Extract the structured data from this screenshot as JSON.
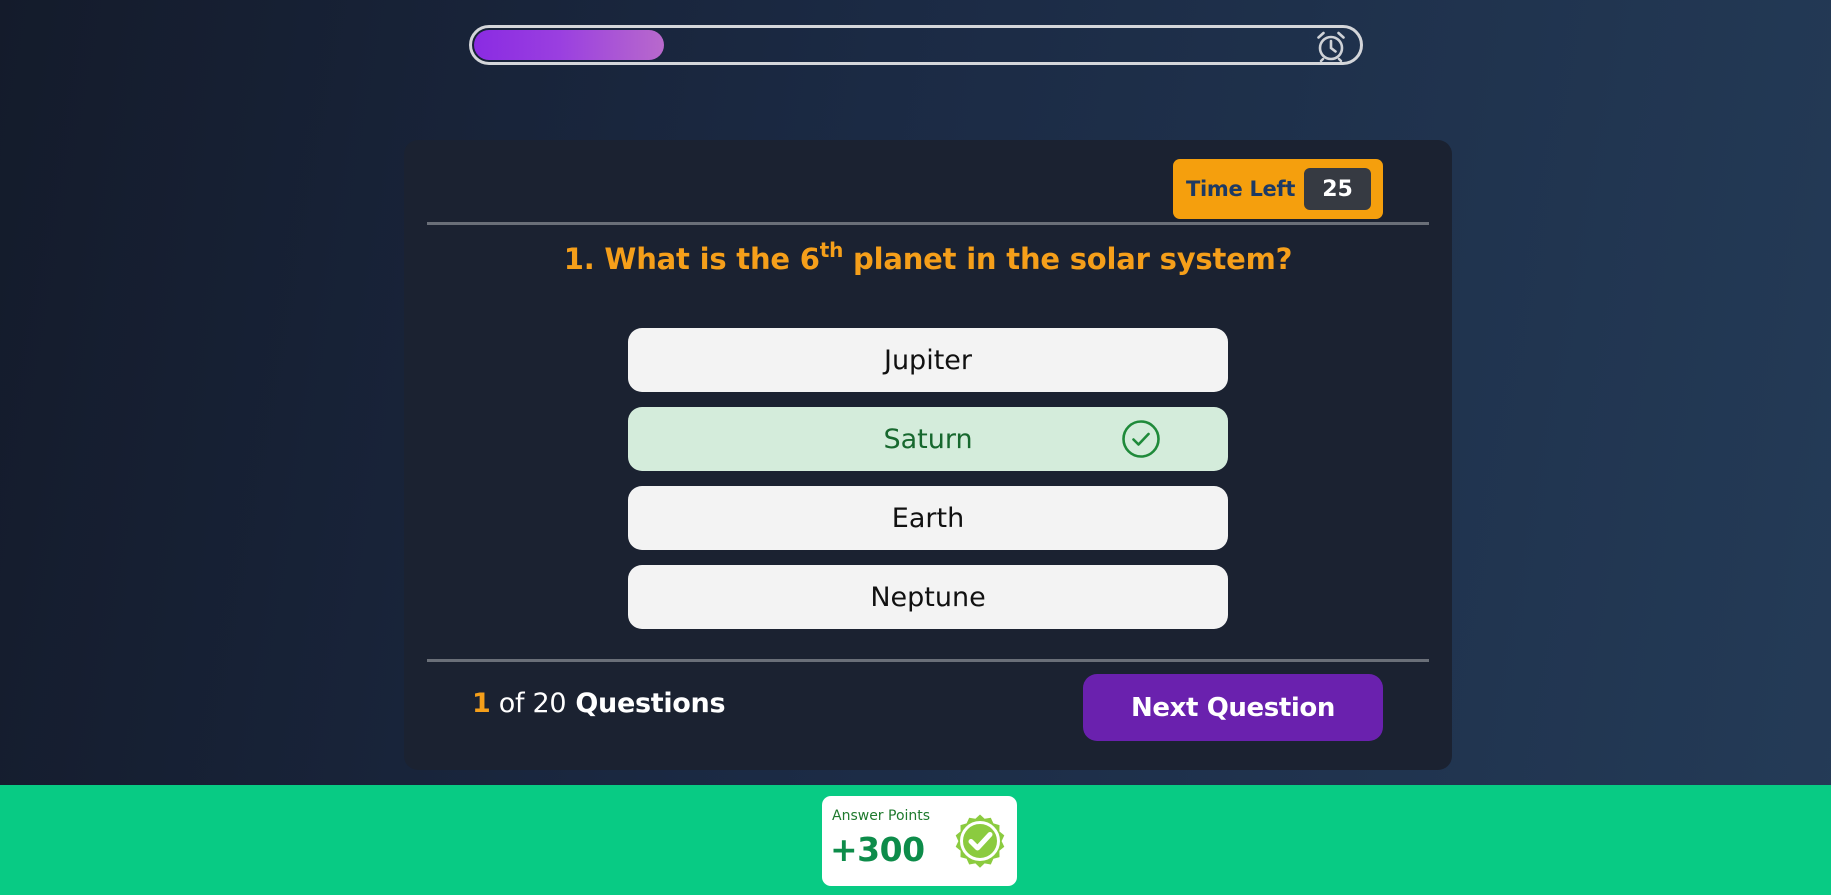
{
  "progress": {
    "fraction": 0.215,
    "icon": "alarm-clock-icon",
    "fill_colors": [
      "#8a2be2",
      "#b869cc"
    ]
  },
  "timer": {
    "label": "Time Left",
    "value": "25",
    "badge_color": "#f59f0d"
  },
  "question": {
    "number_prefix": "1. What is the 6",
    "superscript": "th",
    "suffix": " planet in the solar system?",
    "color": "#f59f1a"
  },
  "options": [
    {
      "label": "Jupiter",
      "state": "default"
    },
    {
      "label": "Saturn",
      "state": "correct",
      "icon": "check-circle-icon"
    },
    {
      "label": "Earth",
      "state": "default"
    },
    {
      "label": "Neptune",
      "state": "default"
    }
  ],
  "footer": {
    "current": "1",
    "of_text": " of ",
    "total": "20",
    "questions_text": " Questions",
    "next_label": "Next Question",
    "next_color": "#6a21ae"
  },
  "points": {
    "label": "Answer Points",
    "value": "+300",
    "icon": "badge-check-icon",
    "bar_color": "#08cb84"
  }
}
